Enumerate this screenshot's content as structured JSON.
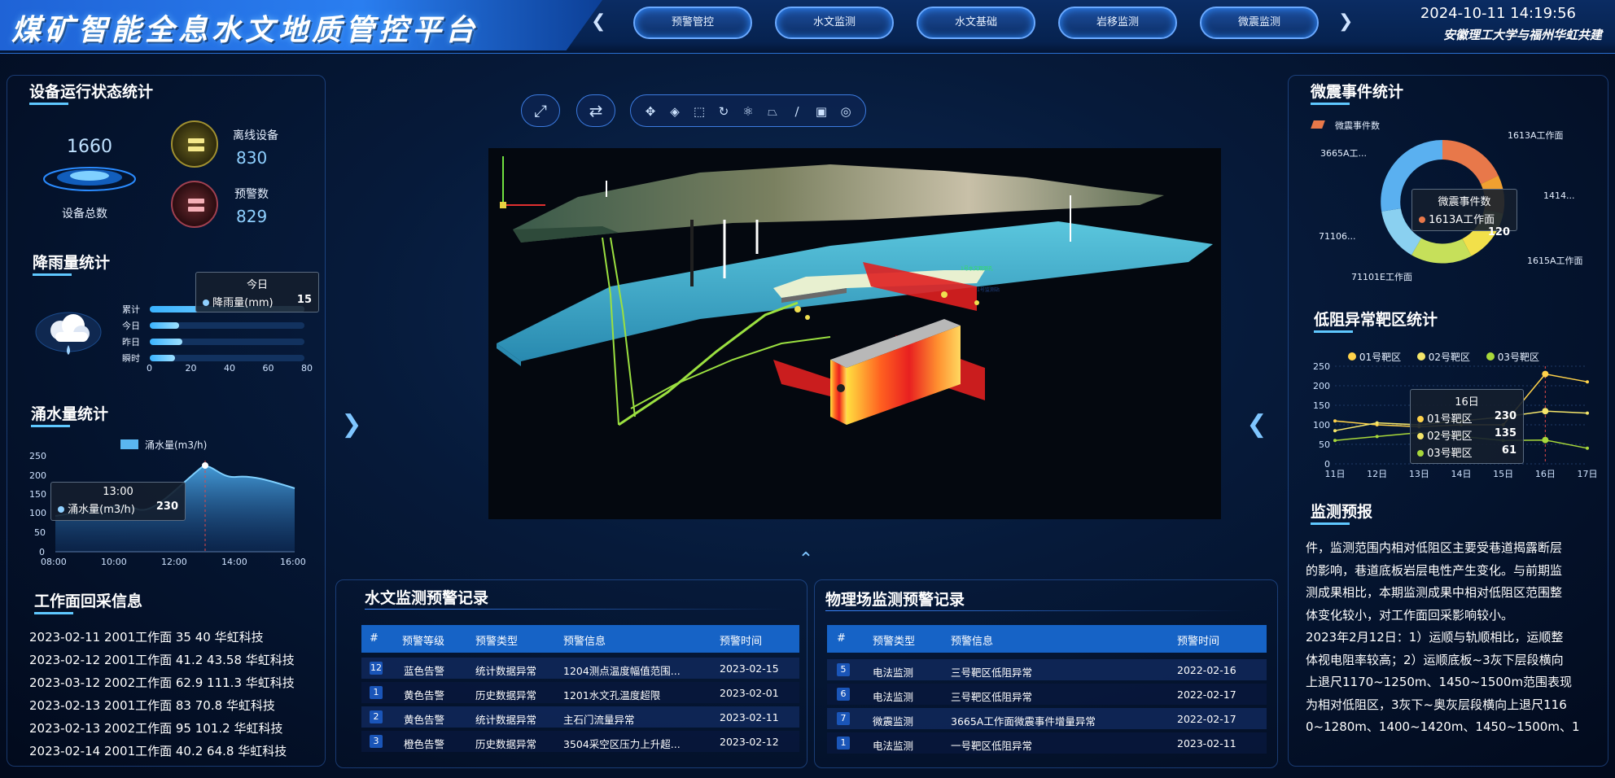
{
  "header": {
    "title": "煤矿智能全息水文地质管控平台",
    "nav": [
      "预警管控",
      "水文监测",
      "水文基础",
      "岩移监测",
      "微震监测"
    ],
    "datetime": "2024-10-11 14:19:56",
    "org": "安徽理工大学与福州华虹共建",
    "prev_icon": "chevron-left-icon",
    "next_icon": "chevron-right-icon"
  },
  "device_status": {
    "title": "设备运行状态统计",
    "total_value": "1660",
    "total_label": "设备总数",
    "offline_label": "离线设备",
    "offline_value": "830",
    "alert_label": "预警数",
    "alert_value": "829"
  },
  "rainfall": {
    "title": "降雨量统计",
    "categories": [
      "累计",
      "今日",
      "昨日",
      "瞬时"
    ],
    "values": [
      80,
      15,
      17,
      13
    ],
    "x_ticks": [
      "0",
      "20",
      "40",
      "60",
      "80"
    ],
    "tooltip_title": "今日",
    "tooltip_series": "降雨量(mm)",
    "tooltip_value": "15"
  },
  "inflow": {
    "title": "涌水量统计",
    "legend": "涌水量(m3/h)",
    "x_ticks": [
      "08:00",
      "10:00",
      "12:00",
      "14:00",
      "16:00"
    ],
    "y_ticks": [
      "250",
      "200",
      "150",
      "100",
      "50",
      "0"
    ],
    "tooltip_title": "13:00",
    "tooltip_series": "涌水量(m3/h)",
    "tooltip_value": "230"
  },
  "workface": {
    "title": "工作面回采信息",
    "records": [
      "2023-02-11 2001工作面 35 40 华虹科技",
      "2023-02-12 2001工作面 41.2 43.58 华虹科技",
      "2023-03-12 2002工作面 62.9 111.3 华虹科技",
      "2023-02-13 2001工作面 83 70.8 华虹科技",
      "2023-02-13 2002工作面 95 101.2 华虹科技",
      "2023-02-14 2001工作面 40.2 64.8 华虹科技"
    ]
  },
  "toolbar": {
    "fullscreen_icon": "fullscreen-icon",
    "swap_icon": "swap-icon",
    "tools": [
      "move-icon",
      "layers-icon",
      "select-icon",
      "refresh-icon",
      "atom-icon",
      "section-icon",
      "ruler-icon",
      "camera-icon",
      "location-icon"
    ]
  },
  "scene": {
    "label_1": "1号水文观测孔",
    "label_2": "1号监测站"
  },
  "hydro_records": {
    "title": "水文监测预警记录",
    "headers": [
      "#",
      "预警等级",
      "预警类型",
      "预警信息",
      "预警时间"
    ],
    "rows": [
      {
        "idx": "12",
        "level": "蓝色告警",
        "type": "统计数据异常",
        "info": "1204测点温度幅值范围...",
        "time": "2023-02-15"
      },
      {
        "idx": "1",
        "level": "黄色告警",
        "type": "历史数据异常",
        "info": "1201水文孔温度超限",
        "time": "2023-02-01"
      },
      {
        "idx": "2",
        "level": "黄色告警",
        "type": "统计数据异常",
        "info": "主石门流量异常",
        "time": "2023-02-11"
      },
      {
        "idx": "3",
        "level": "橙色告警",
        "type": "历史数据异常",
        "info": "3504采空区压力上升超...",
        "time": "2023-02-12"
      }
    ]
  },
  "physics_records": {
    "title": "物理场监测预警记录",
    "headers": [
      "#",
      "预警类型",
      "预警信息",
      "预警时间"
    ],
    "rows": [
      {
        "idx": "5",
        "type": "电法监测",
        "info": "三号靶区低阻异常",
        "time": "2022-02-16"
      },
      {
        "idx": "6",
        "type": "电法监测",
        "info": "三号靶区低阻异常",
        "time": "2022-02-17"
      },
      {
        "idx": "7",
        "type": "微震监测",
        "info": "3665A工作面微震事件增量异常",
        "time": "2022-02-17"
      },
      {
        "idx": "1",
        "type": "电法监测",
        "info": "一号靶区低阻异常",
        "time": "2023-02-11"
      }
    ]
  },
  "micro_seismic": {
    "title": "微震事件统计",
    "legend": "微震事件数",
    "center_title": "微震事件数",
    "center_series": "1613A工作面",
    "center_value": "120",
    "labels": [
      "1613A工作面",
      "1414...",
      "1615A工作面",
      "71101E工作面",
      "71106...",
      "3665A工..."
    ],
    "colors": [
      "#e8784a",
      "#f0a030",
      "#f2e04a",
      "#c6e05a",
      "#8ad0f0",
      "#5ab0f0"
    ]
  },
  "chart_data": {
    "type": "line",
    "categories": [
      "11日",
      "12日",
      "13日",
      "14日",
      "15日",
      "16日",
      "17日"
    ],
    "y_ticks": [
      "250",
      "200",
      "150",
      "100",
      "50",
      "0"
    ],
    "ylim": [
      0,
      250
    ],
    "series": [
      {
        "name": "01号靶区",
        "values": [
          110,
          100,
          95,
          100,
          100,
          230,
          210
        ],
        "color": "#ffd24a"
      },
      {
        "name": "02号靶区",
        "values": [
          85,
          105,
          100,
          110,
          120,
          135,
          130
        ],
        "color": "#f5e66a"
      },
      {
        "name": "03号靶区",
        "values": [
          60,
          70,
          80,
          70,
          60,
          61,
          40
        ],
        "color": "#a8d83a"
      }
    ],
    "title": "低阻异常靶区统计",
    "tooltip_title": "16日",
    "tooltip_values": [
      "230",
      "135",
      "61"
    ]
  },
  "forecast": {
    "title": "监测预报",
    "lines": [
      "件，监测范围内相对低阻区主要受巷道揭露断层",
      "的影响，巷道底板岩层电性产生变化。与前期监",
      "测成果相比，本期监测成果中相对低阻区范围整",
      "体变化较小，对工作面回采影响较小。",
      "2023年2月12日：1）运顺与轨顺相比，运顺整",
      "体视电阻率较高；2）运顺底板~3灰下层段横向",
      "上退尺1170~1250m、1450~1500m范围表现",
      "为相对低阻区，3灰下~奥灰层段横向上退尺116",
      "0~1280m、1400~1420m、1450~1500m、1"
    ]
  }
}
